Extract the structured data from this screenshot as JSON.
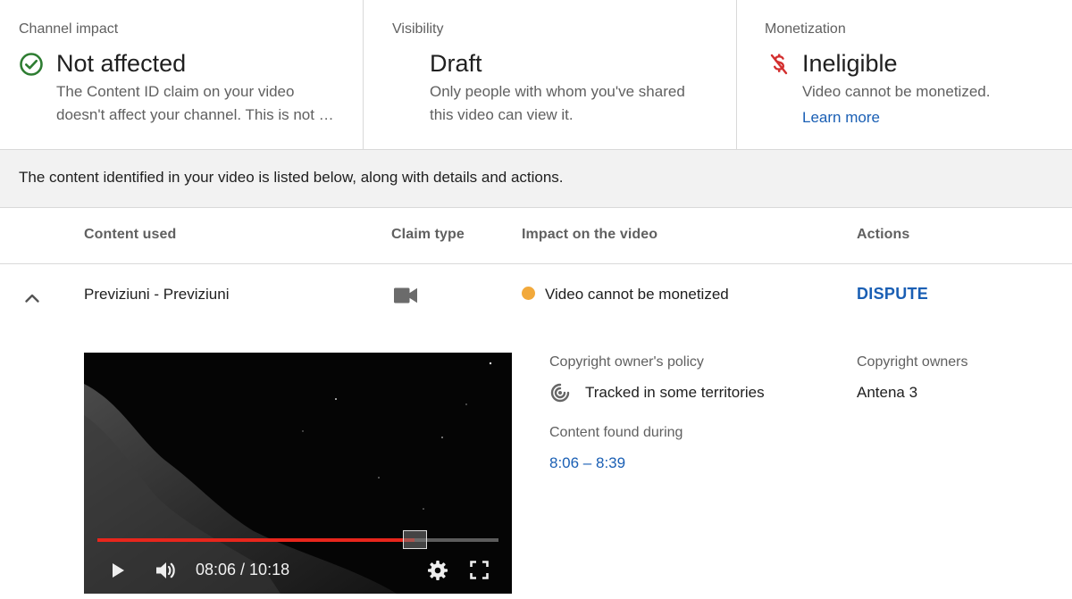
{
  "summary": {
    "channel_impact": {
      "label": "Channel impact",
      "value": "Not affected",
      "desc_line1": "The Content ID claim on your video",
      "desc_line2": "doesn't affect your channel. This is not …",
      "icon": "check-circle-icon",
      "icon_color": "#2e7d32"
    },
    "visibility": {
      "label": "Visibility",
      "value": "Draft",
      "desc_line1": "Only people with whom you've shared",
      "desc_line2": "this video can view it."
    },
    "monetization": {
      "label": "Monetization",
      "value": "Ineligible",
      "desc": "Video cannot be monetized.",
      "link": "Learn more",
      "icon": "no-dollar-icon",
      "icon_color": "#d32f2f"
    }
  },
  "info_bar": {
    "text": "The content identified in your video is listed below, along with details and actions."
  },
  "table": {
    "headers": {
      "content_used": "Content used",
      "claim_type": "Claim type",
      "impact": "Impact on the video",
      "actions": "Actions"
    },
    "rows": [
      {
        "content_used": "Previziuni - Previziuni",
        "claim_type_icon": "video-camera-icon",
        "impact": "Video cannot be monetized",
        "impact_color": "#f2a93b",
        "action": "DISPUTE",
        "expanded": true,
        "details": {
          "player": {
            "time": "08:06 / 10:18",
            "progress": 0.79
          },
          "policy_label": "Copyright owner's policy",
          "policy_value": "Tracked in some territories",
          "policy_icon": "tracked-icon",
          "found_label": "Content found during",
          "found_value": "8:06 – 8:39",
          "owners_label": "Copyright owners",
          "owners_value": "Antena 3"
        }
      }
    ]
  },
  "colors": {
    "link_blue": "#1a5fb4",
    "progress_red": "#e8261c"
  }
}
